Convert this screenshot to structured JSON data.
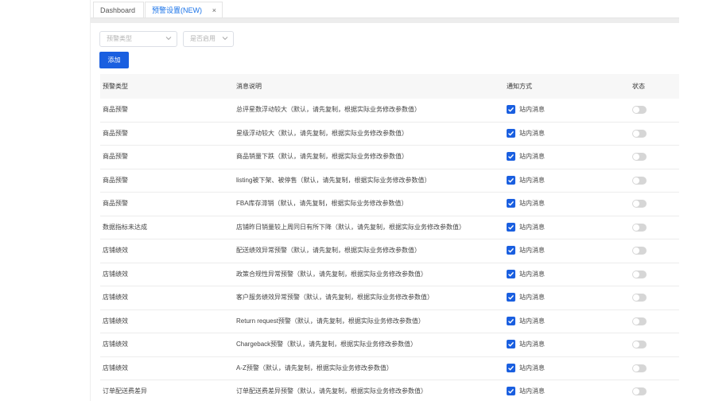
{
  "tabs": [
    {
      "label": "Dashboard"
    },
    {
      "label": "预警设置(NEW)",
      "close": "×"
    }
  ],
  "filters": {
    "type_placeholder": "预警类型",
    "enabled_placeholder": "是否启用"
  },
  "add_button": "添加",
  "table": {
    "headers": [
      "预警类型",
      "消息说明",
      "通知方式",
      "状态"
    ],
    "rows": [
      {
        "type": "商品预警",
        "message": "总评星数浮动较大（默认，请先复制，根据实际业务修改参数值）",
        "notify": "站内消息",
        "checked": true,
        "enabled": false
      },
      {
        "type": "商品预警",
        "message": "星级浮动较大（默认，请先复制，根据实际业务修改参数值）",
        "notify": "站内消息",
        "checked": true,
        "enabled": false
      },
      {
        "type": "商品预警",
        "message": "商品销量下跌（默认，请先复制，根据实际业务修改参数值）",
        "notify": "站内消息",
        "checked": true,
        "enabled": false
      },
      {
        "type": "商品预警",
        "message": "listing被下架、被停售（默认，请先复制，根据实际业务修改参数值）",
        "notify": "站内消息",
        "checked": true,
        "enabled": false
      },
      {
        "type": "商品预警",
        "message": "FBA库存滞销（默认，请先复制，根据实际业务修改参数值）",
        "notify": "站内消息",
        "checked": true,
        "enabled": false
      },
      {
        "type": "数据指标未达成",
        "message": "店铺昨日销量较上周同日有所下降（默认，请先复制，根据实际业务修改参数值）",
        "notify": "站内消息",
        "checked": true,
        "enabled": false
      },
      {
        "type": "店铺绩效",
        "message": "配送绩效异常预警（默认，请先复制，根据实际业务修改参数值）",
        "notify": "站内消息",
        "checked": true,
        "enabled": false
      },
      {
        "type": "店铺绩效",
        "message": "政策合规性异常预警（默认，请先复制，根据实际业务修改参数值）",
        "notify": "站内消息",
        "checked": true,
        "enabled": false
      },
      {
        "type": "店铺绩效",
        "message": "客户服务绩效异常预警（默认，请先复制，根据实际业务修改参数值）",
        "notify": "站内消息",
        "checked": true,
        "enabled": false
      },
      {
        "type": "店铺绩效",
        "message": "Return request预警（默认，请先复制，根据实际业务修改参数值）",
        "notify": "站内消息",
        "checked": true,
        "enabled": false
      },
      {
        "type": "店铺绩效",
        "message": "Chargeback预警（默认，请先复制，根据实际业务修改参数值）",
        "notify": "站内消息",
        "checked": true,
        "enabled": false
      },
      {
        "type": "店铺绩效",
        "message": "A-Z预警（默认，请先复制，根据实际业务修改参数值）",
        "notify": "站内消息",
        "checked": true,
        "enabled": false
      },
      {
        "type": "订单配送费差异",
        "message": "订单配送费差异预警（默认，请先复制，根据实际业务修改参数值）",
        "notify": "站内消息",
        "checked": true,
        "enabled": false
      }
    ]
  },
  "colors": {
    "accent": "#1a5fe0",
    "active_tab": "#1a73e8",
    "toggle_off": "#d6d6d6"
  }
}
